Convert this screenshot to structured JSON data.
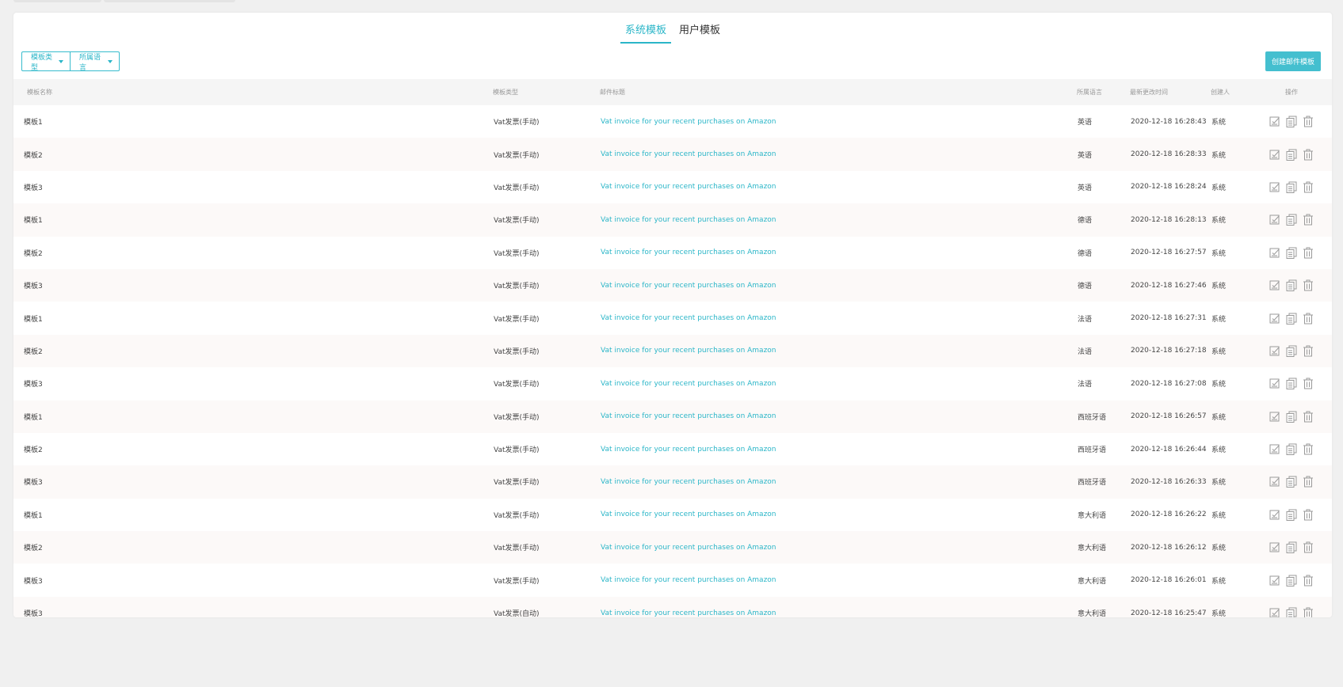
{
  "tabs": [
    {
      "label": "系统模板",
      "active": true
    },
    {
      "label": "用户模板",
      "active": false
    }
  ],
  "filters": [
    {
      "label": "模板类型"
    },
    {
      "label": "所属语言"
    }
  ],
  "create_button": "创建邮件模板",
  "columns": {
    "name": "模板名称",
    "type": "模板类型",
    "subject": "邮件标题",
    "language": "所属语言",
    "updated": "最新更改时间",
    "creator": "创建人",
    "ops": "操作"
  },
  "rows": [
    {
      "name": "模板1",
      "type": "Vat发票(手动)",
      "subject": "Vat invoice for your recent purchases on Amazon",
      "language": "英语",
      "updated": "2020-12-18 16:28:43",
      "creator": "系统"
    },
    {
      "name": "模板2",
      "type": "Vat发票(手动)",
      "subject": "Vat invoice for your recent purchases on Amazon",
      "language": "英语",
      "updated": "2020-12-18 16:28:33",
      "creator": "系统"
    },
    {
      "name": "模板3",
      "type": "Vat发票(手动)",
      "subject": "Vat invoice for your recent purchases on Amazon",
      "language": "英语",
      "updated": "2020-12-18 16:28:24",
      "creator": "系统"
    },
    {
      "name": "模板1",
      "type": "Vat发票(手动)",
      "subject": "Vat invoice for your recent purchases on Amazon",
      "language": "德语",
      "updated": "2020-12-18 16:28:13",
      "creator": "系统"
    },
    {
      "name": "模板2",
      "type": "Vat发票(手动)",
      "subject": "Vat invoice for your recent purchases on Amazon",
      "language": "德语",
      "updated": "2020-12-18 16:27:57",
      "creator": "系统"
    },
    {
      "name": "模板3",
      "type": "Vat发票(手动)",
      "subject": "Vat invoice for your recent purchases on Amazon",
      "language": "德语",
      "updated": "2020-12-18 16:27:46",
      "creator": "系统"
    },
    {
      "name": "模板1",
      "type": "Vat发票(手动)",
      "subject": "Vat invoice for your recent purchases on Amazon",
      "language": "法语",
      "updated": "2020-12-18 16:27:31",
      "creator": "系统"
    },
    {
      "name": "模板2",
      "type": "Vat发票(手动)",
      "subject": "Vat invoice for your recent purchases on Amazon",
      "language": "法语",
      "updated": "2020-12-18 16:27:18",
      "creator": "系统"
    },
    {
      "name": "模板3",
      "type": "Vat发票(手动)",
      "subject": "Vat invoice for your recent purchases on Amazon",
      "language": "法语",
      "updated": "2020-12-18 16:27:08",
      "creator": "系统"
    },
    {
      "name": "模板1",
      "type": "Vat发票(手动)",
      "subject": "Vat invoice for your recent purchases on Amazon",
      "language": "西班牙语",
      "updated": "2020-12-18 16:26:57",
      "creator": "系统"
    },
    {
      "name": "模板2",
      "type": "Vat发票(手动)",
      "subject": "Vat invoice for your recent purchases on Amazon",
      "language": "西班牙语",
      "updated": "2020-12-18 16:26:44",
      "creator": "系统"
    },
    {
      "name": "模板3",
      "type": "Vat发票(手动)",
      "subject": "Vat invoice for your recent purchases on Amazon",
      "language": "西班牙语",
      "updated": "2020-12-18 16:26:33",
      "creator": "系统"
    },
    {
      "name": "模板1",
      "type": "Vat发票(手动)",
      "subject": "Vat invoice for your recent purchases on Amazon",
      "language": "意大利语",
      "updated": "2020-12-18 16:26:22",
      "creator": "系统"
    },
    {
      "name": "模板2",
      "type": "Vat发票(手动)",
      "subject": "Vat invoice for your recent purchases on Amazon",
      "language": "意大利语",
      "updated": "2020-12-18 16:26:12",
      "creator": "系统"
    },
    {
      "name": "模板3",
      "type": "Vat发票(手动)",
      "subject": "Vat invoice for your recent purchases on Amazon",
      "language": "意大利语",
      "updated": "2020-12-18 16:26:01",
      "creator": "系统"
    },
    {
      "name": "模板3",
      "type": "Vat发票(自动)",
      "subject": "Vat invoice for your recent purchases on Amazon",
      "language": "意大利语",
      "updated": "2020-12-18 16:25:47",
      "creator": "系统"
    }
  ],
  "row_actions": [
    "edit-icon",
    "copy-icon",
    "delete-icon"
  ],
  "colors": {
    "accent": "#2bb6c8",
    "button": "#44bfcf",
    "header_bg": "#f5f5f5",
    "alt_row_bg": "#fcf9f8",
    "icon": "#9a9a9a"
  }
}
